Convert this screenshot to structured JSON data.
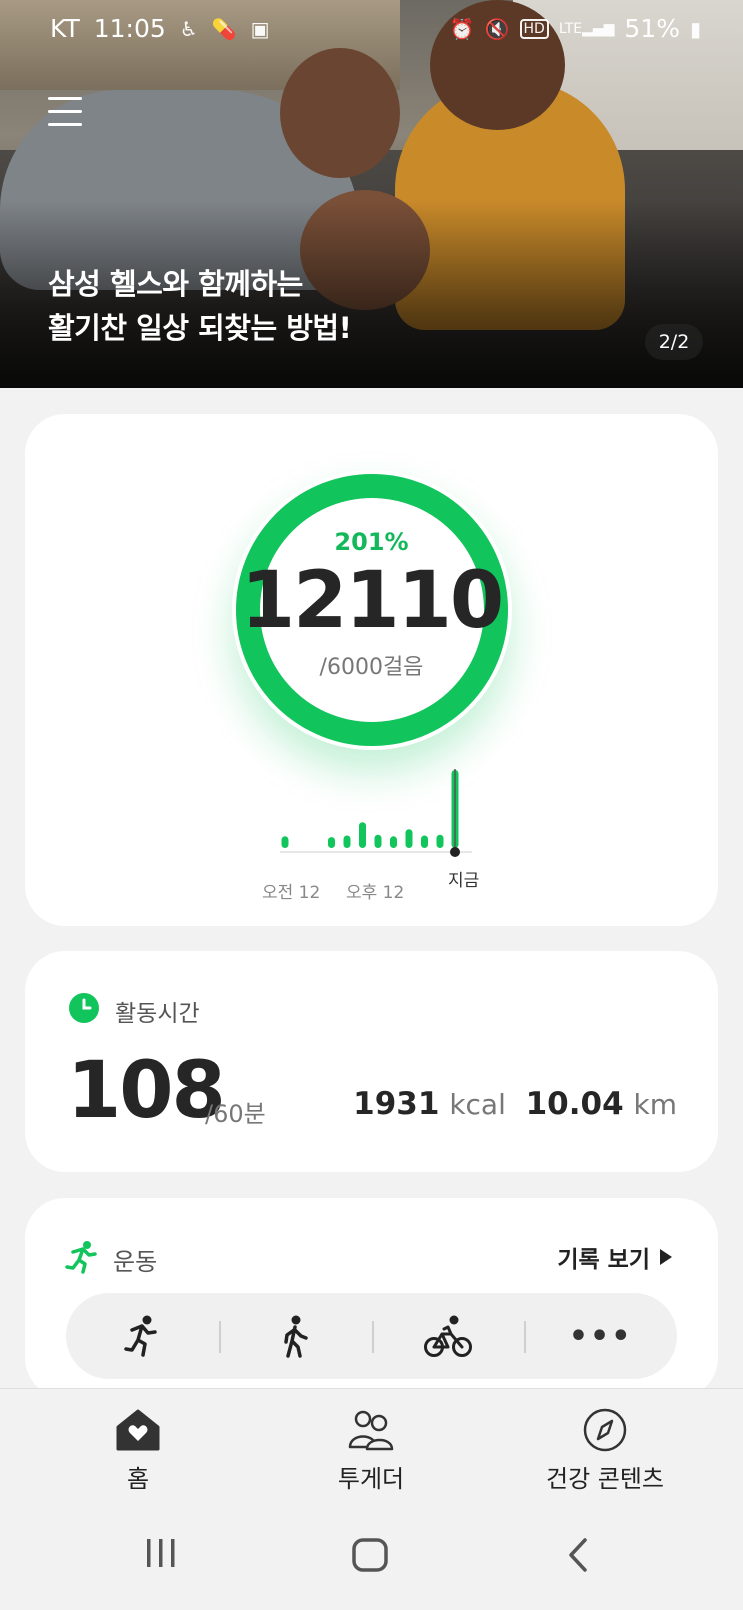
{
  "status_bar": {
    "carrier": "KT",
    "time": "11:05",
    "battery": "51%",
    "left_icons": [
      "accessibility-icon",
      "pill-icon",
      "camera-icon"
    ],
    "right_icons": [
      "alarm-icon",
      "mute-icon",
      "hd-icon",
      "lte-signal-icon",
      "battery-icon"
    ]
  },
  "banner": {
    "title_line1": "삼성 헬스와 함께하는",
    "title_line2": "활기찬 일상 되찾는 방법!",
    "page_indicator": "2/2"
  },
  "steps": {
    "percent": "201%",
    "count": "12110",
    "goal": "/6000걸음",
    "progress_fraction": 1.0,
    "accent_color": "#11c45c",
    "axis_labels": [
      "오전 12",
      "오후 12"
    ],
    "now_label": "지금",
    "hourly_bars": [
      0.15,
      0,
      0,
      0.14,
      0.16,
      0.33,
      0.17,
      0.15,
      0.24,
      0.16,
      0.17,
      1.0
    ]
  },
  "activity": {
    "label": "활동시간",
    "minutes": "108",
    "goal": "/60분",
    "calories_value": "1931",
    "calories_unit": "kcal",
    "distance_value": "10.04",
    "distance_unit": "km"
  },
  "exercise": {
    "label": "운동",
    "history_link": "기록 보기",
    "shortcuts": [
      "running-icon",
      "walking-icon",
      "cycling-icon",
      "more-icon"
    ],
    "more_label": "•••"
  },
  "bottom_nav": {
    "items": [
      {
        "label": "홈",
        "icon": "home-heart-icon"
      },
      {
        "label": "투게더",
        "icon": "people-icon"
      },
      {
        "label": "건강 콘텐츠",
        "icon": "compass-icon"
      }
    ]
  },
  "system_nav": [
    "recent-apps-icon",
    "home-button-icon",
    "back-icon"
  ]
}
